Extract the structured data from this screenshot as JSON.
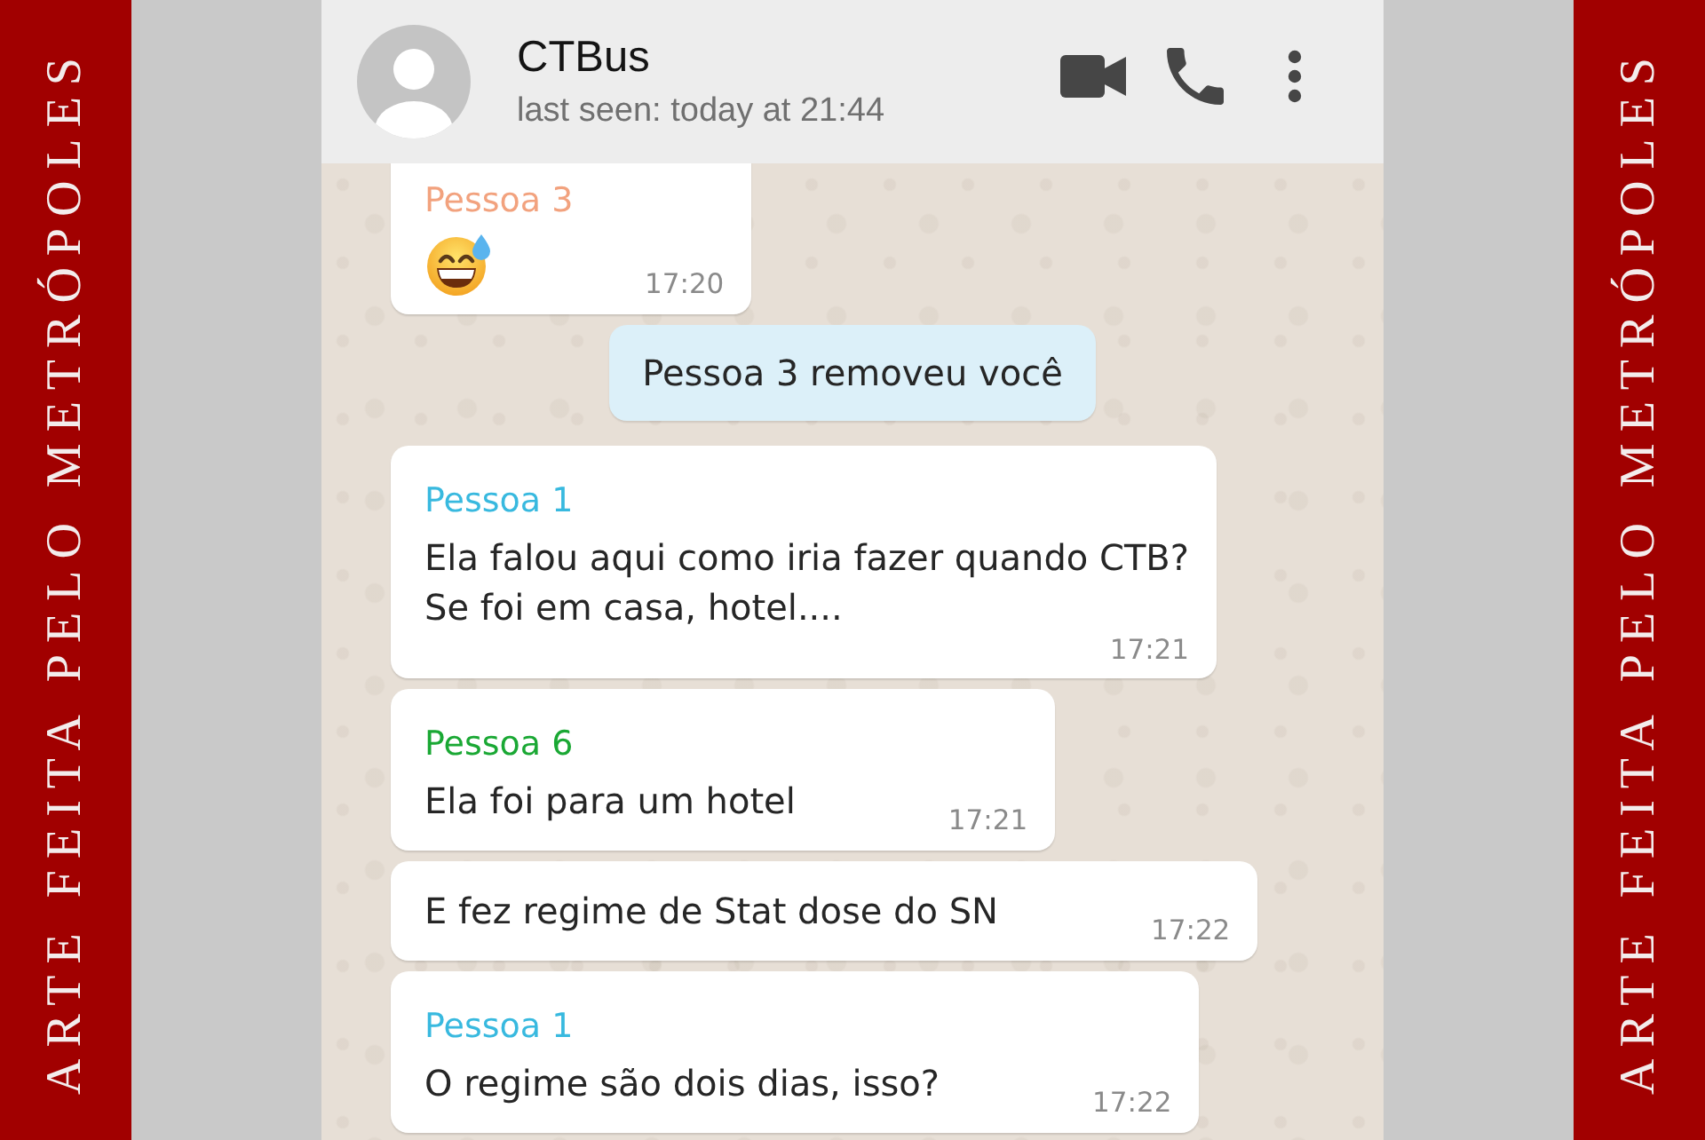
{
  "side_credits": [
    {
      "text": "ARTE FEITA PELO METRÓPOLES"
    },
    {
      "text": "ARTE FEITA PELO METRÓPOLES"
    }
  ],
  "header": {
    "title": "CTBus",
    "subtitle": "last seen: today at 21:44"
  },
  "messages": [
    {
      "kind": "emoji",
      "sender": "Pessoa 3",
      "color": "#f2a27e",
      "time": "17:20"
    },
    {
      "kind": "notice",
      "text": "Pessoa 3 removeu você"
    },
    {
      "kind": "text",
      "sender": "Pessoa 1",
      "color": "#38b9df",
      "text": "Ela falou aqui como iria fazer quando CTB?\nSe foi em casa, hotel....",
      "time": "17:21"
    },
    {
      "kind": "text",
      "sender": "Pessoa 6",
      "color": "#1aa834",
      "text": "Ela foi para um hotel",
      "time": "17:21"
    },
    {
      "kind": "text",
      "text": "E fez regime de Stat dose do SN",
      "time": "17:22"
    },
    {
      "kind": "text",
      "sender": "Pessoa 1",
      "color": "#38b9df",
      "text": "O regime são dois dias, isso?",
      "time": "17:22"
    }
  ]
}
